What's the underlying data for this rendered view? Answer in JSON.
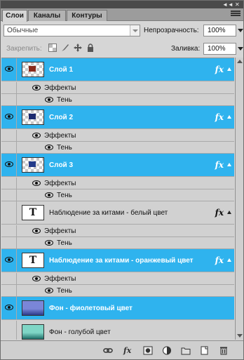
{
  "panel": {
    "tabs": [
      {
        "label": "Слои",
        "active": true
      },
      {
        "label": "Каналы",
        "active": false
      },
      {
        "label": "Контуры",
        "active": false
      }
    ],
    "titlebar_controls": {
      "collapse": "◄◄",
      "close": "✕"
    },
    "blend_mode": {
      "value": "Обычные",
      "placeholder": "Обычные"
    },
    "opacity": {
      "label": "Непрозрачность:",
      "value": "100%"
    },
    "lock": {
      "label": "Закрепить:"
    },
    "fill": {
      "label": "Заливка:",
      "value": "100%"
    }
  },
  "layers": [
    {
      "kind": "layer",
      "name": "Слой 1",
      "visible": true,
      "selected": true,
      "thumb": "checker",
      "swatch_color": "#8a2a1a",
      "fx": "fx"
    },
    {
      "kind": "effects",
      "label": "Эффекты"
    },
    {
      "kind": "effect",
      "label": "Тень"
    },
    {
      "kind": "layer",
      "name": "Слой 2",
      "visible": true,
      "selected": true,
      "thumb": "checker",
      "swatch_color": "#1c2a6e",
      "fx": "fx"
    },
    {
      "kind": "effects",
      "label": "Эффекты"
    },
    {
      "kind": "effect",
      "label": "Тень"
    },
    {
      "kind": "layer",
      "name": "Слой 3",
      "visible": true,
      "selected": true,
      "thumb": "checker",
      "swatch_color": "#233b8a",
      "fx": "fx"
    },
    {
      "kind": "effects",
      "label": "Эффекты"
    },
    {
      "kind": "effect",
      "label": "Тень"
    },
    {
      "kind": "layer",
      "name": "Наблюдение за китами - белый цвет",
      "visible": false,
      "selected": false,
      "thumb": "text",
      "thumb_text": "T",
      "fx": "fx"
    },
    {
      "kind": "effects",
      "label": "Эффекты"
    },
    {
      "kind": "effect",
      "label": "Тень"
    },
    {
      "kind": "layer",
      "name": "Наблюдение за китами - оранжевый цвет",
      "visible": true,
      "selected": true,
      "thumb": "text",
      "thumb_text": "T",
      "fx": "fx"
    },
    {
      "kind": "effects",
      "label": "Эффекты"
    },
    {
      "kind": "effect",
      "label": "Тень"
    },
    {
      "kind": "layer",
      "name": "Фон - фиолетовый цвет",
      "visible": true,
      "selected": true,
      "thumb": "image",
      "thumb_colors": [
        "#7a86d8",
        "#2b3a8a"
      ],
      "fx": ""
    },
    {
      "kind": "layer",
      "name": "Фон - голубой цвет",
      "visible": false,
      "selected": false,
      "thumb": "image",
      "thumb_colors": [
        "#7fd6c6",
        "#1e6e68"
      ],
      "fx": ""
    }
  ],
  "footer_icons": [
    "link-layers-icon",
    "add-layer-style-icon",
    "add-mask-icon",
    "adjustment-layer-icon",
    "new-group-icon",
    "new-layer-icon",
    "delete-layer-icon"
  ],
  "colors": {
    "selection": "#2fb3ee",
    "panel": "#d6d6d6",
    "list": "#d1d1d1"
  }
}
